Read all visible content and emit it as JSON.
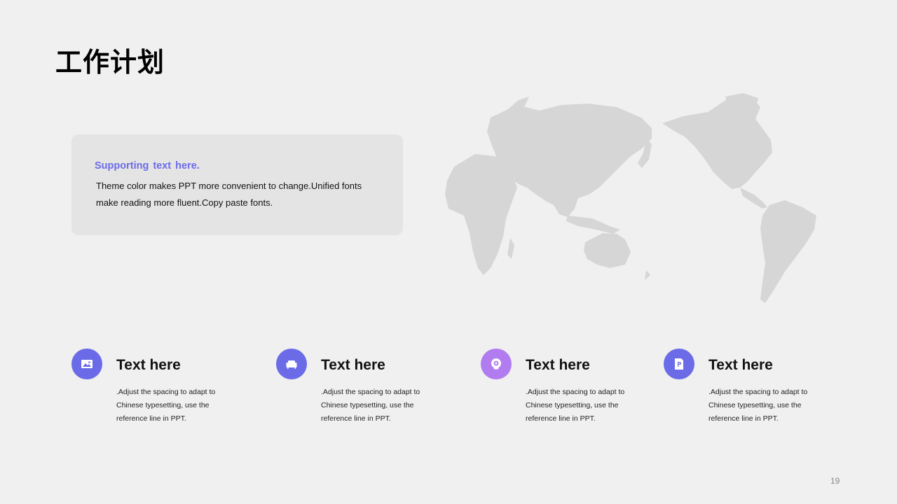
{
  "slide": {
    "title": "工作计划",
    "page_number": "19"
  },
  "info_card": {
    "supporting": "Supporting  text here.",
    "body": "Theme color makes PPT more convenient to change.Unified fonts make reading more fluent.Copy paste fonts."
  },
  "features": [
    {
      "icon": "image-icon",
      "title": "Text here",
      "desc": ".Adjust the spacing to adapt to Chinese typesetting, use the reference line in PPT."
    },
    {
      "icon": "sofa-icon",
      "title": "Text here",
      "desc": ".Adjust the spacing to adapt to Chinese typesetting, use the reference line in PPT."
    },
    {
      "icon": "webcam-icon",
      "title": "Text here",
      "desc": ".Adjust the spacing to adapt to Chinese typesetting, use the reference line in PPT."
    },
    {
      "icon": "ppt-file-icon",
      "title": "Text here",
      "desc": ".Adjust the spacing to adapt to Chinese typesetting, use the reference line in PPT."
    }
  ],
  "colors": {
    "accent": "#6b6be8",
    "accent_light": "#b07cf0",
    "map": "#d6d6d6",
    "background": "#f0f0f0"
  }
}
